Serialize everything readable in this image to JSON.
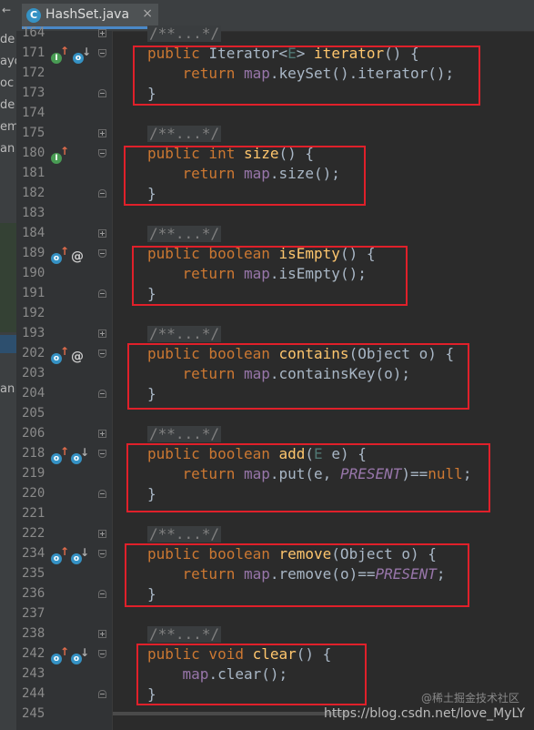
{
  "left_panel": {
    "arrow": "←",
    "items": [
      "de",
      "ayo",
      "oc",
      "de",
      "em",
      "an",
      "an"
    ]
  },
  "tab": {
    "icon_letter": "C",
    "label": "HashSet.java",
    "close": "×"
  },
  "gutter": {
    "lines": [
      {
        "num": "164",
        "icons": [],
        "fold": "plus"
      },
      {
        "num": "171",
        "icons": [
          "implements-icon",
          "overridden-icon"
        ],
        "fold": "open"
      },
      {
        "num": "172",
        "icons": [],
        "fold": ""
      },
      {
        "num": "173",
        "icons": [],
        "fold": "close"
      },
      {
        "num": "174",
        "icons": [],
        "fold": ""
      },
      {
        "num": "175",
        "icons": [],
        "fold": "plus"
      },
      {
        "num": "180",
        "icons": [
          "implements-icon"
        ],
        "fold": "open"
      },
      {
        "num": "181",
        "icons": [],
        "fold": ""
      },
      {
        "num": "182",
        "icons": [],
        "fold": "close"
      },
      {
        "num": "183",
        "icons": [],
        "fold": ""
      },
      {
        "num": "184",
        "icons": [],
        "fold": "plus"
      },
      {
        "num": "189",
        "icons": [
          "overrides-icon",
          "at-icon"
        ],
        "fold": "open"
      },
      {
        "num": "190",
        "icons": [],
        "fold": ""
      },
      {
        "num": "191",
        "icons": [],
        "fold": "close"
      },
      {
        "num": "192",
        "icons": [],
        "fold": ""
      },
      {
        "num": "193",
        "icons": [],
        "fold": "plus"
      },
      {
        "num": "202",
        "icons": [
          "overrides-icon",
          "at-icon"
        ],
        "fold": "open"
      },
      {
        "num": "203",
        "icons": [],
        "fold": ""
      },
      {
        "num": "204",
        "icons": [],
        "fold": "close"
      },
      {
        "num": "205",
        "icons": [],
        "fold": ""
      },
      {
        "num": "206",
        "icons": [],
        "fold": "plus"
      },
      {
        "num": "218",
        "icons": [
          "overrides-icon",
          "overridden-icon"
        ],
        "fold": "open"
      },
      {
        "num": "219",
        "icons": [],
        "fold": ""
      },
      {
        "num": "220",
        "icons": [],
        "fold": "close"
      },
      {
        "num": "221",
        "icons": [],
        "fold": ""
      },
      {
        "num": "222",
        "icons": [],
        "fold": "plus"
      },
      {
        "num": "234",
        "icons": [
          "overrides-icon",
          "overridden-icon"
        ],
        "fold": "open"
      },
      {
        "num": "235",
        "icons": [],
        "fold": ""
      },
      {
        "num": "236",
        "icons": [],
        "fold": "close"
      },
      {
        "num": "237",
        "icons": [],
        "fold": ""
      },
      {
        "num": "238",
        "icons": [],
        "fold": "plus"
      },
      {
        "num": "242",
        "icons": [
          "overrides-icon",
          "overridden-icon"
        ],
        "fold": "open"
      },
      {
        "num": "243",
        "icons": [],
        "fold": ""
      },
      {
        "num": "244",
        "icons": [],
        "fold": "close"
      },
      {
        "num": "245",
        "icons": [],
        "fold": ""
      }
    ]
  },
  "code": {
    "lines": [
      [
        {
          "t": "/**...*/",
          "c": "comment"
        }
      ],
      [
        {
          "t": "public ",
          "c": "kw"
        },
        {
          "t": "Iterator<",
          "c": ""
        },
        {
          "t": "E",
          "c": "gen"
        },
        {
          "t": "> ",
          "c": ""
        },
        {
          "t": "iterator",
          "c": "fn"
        },
        {
          "t": "() {",
          "c": ""
        }
      ],
      [
        {
          "t": "    return ",
          "c": "kw"
        },
        {
          "t": "map",
          "c": "fld"
        },
        {
          "t": ".keySet().iterator();",
          "c": ""
        }
      ],
      [
        {
          "t": "}",
          "c": ""
        }
      ],
      [],
      [
        {
          "t": "/**...*/",
          "c": "comment"
        }
      ],
      [
        {
          "t": "public int ",
          "c": "kw"
        },
        {
          "t": "size",
          "c": "fn"
        },
        {
          "t": "() {",
          "c": ""
        }
      ],
      [
        {
          "t": "    return ",
          "c": "kw"
        },
        {
          "t": "map",
          "c": "fld"
        },
        {
          "t": ".size();",
          "c": ""
        }
      ],
      [
        {
          "t": "}",
          "c": ""
        }
      ],
      [],
      [
        {
          "t": "/**...*/",
          "c": "comment"
        }
      ],
      [
        {
          "t": "public boolean ",
          "c": "kw"
        },
        {
          "t": "isEmpty",
          "c": "fn"
        },
        {
          "t": "() {",
          "c": ""
        }
      ],
      [
        {
          "t": "    return ",
          "c": "kw"
        },
        {
          "t": "map",
          "c": "fld"
        },
        {
          "t": ".isEmpty();",
          "c": ""
        }
      ],
      [
        {
          "t": "}",
          "c": ""
        }
      ],
      [],
      [
        {
          "t": "/**...*/",
          "c": "comment"
        }
      ],
      [
        {
          "t": "public boolean ",
          "c": "kw"
        },
        {
          "t": "contains",
          "c": "fn"
        },
        {
          "t": "(Object o) {",
          "c": ""
        }
      ],
      [
        {
          "t": "    return ",
          "c": "kw"
        },
        {
          "t": "map",
          "c": "fld"
        },
        {
          "t": ".containsKey(o);",
          "c": ""
        }
      ],
      [
        {
          "t": "}",
          "c": ""
        }
      ],
      [],
      [
        {
          "t": "/**...*/",
          "c": "comment"
        }
      ],
      [
        {
          "t": "public boolean ",
          "c": "kw"
        },
        {
          "t": "add",
          "c": "fn"
        },
        {
          "t": "(",
          "c": ""
        },
        {
          "t": "E",
          "c": "gen"
        },
        {
          "t": " e) {",
          "c": ""
        }
      ],
      [
        {
          "t": "    return ",
          "c": "kw"
        },
        {
          "t": "map",
          "c": "fld"
        },
        {
          "t": ".put(e, ",
          "c": ""
        },
        {
          "t": "PRESENT",
          "c": "const"
        },
        {
          "t": ")==",
          "c": ""
        },
        {
          "t": "null",
          "c": "kw"
        },
        {
          "t": ";",
          "c": ""
        }
      ],
      [
        {
          "t": "}",
          "c": ""
        }
      ],
      [],
      [
        {
          "t": "/**...*/",
          "c": "comment"
        }
      ],
      [
        {
          "t": "public boolean ",
          "c": "kw"
        },
        {
          "t": "remove",
          "c": "fn"
        },
        {
          "t": "(Object o) {",
          "c": ""
        }
      ],
      [
        {
          "t": "    return ",
          "c": "kw"
        },
        {
          "t": "map",
          "c": "fld"
        },
        {
          "t": ".remove(o)==",
          "c": ""
        },
        {
          "t": "PRESENT",
          "c": "const"
        },
        {
          "t": ";",
          "c": ""
        }
      ],
      [
        {
          "t": "}",
          "c": ""
        }
      ],
      [],
      [
        {
          "t": "/**...*/",
          "c": "comment"
        }
      ],
      [
        {
          "t": "public void ",
          "c": "kw"
        },
        {
          "t": "clear",
          "c": "fn"
        },
        {
          "t": "() {",
          "c": ""
        }
      ],
      [
        {
          "t": "    ",
          "c": ""
        },
        {
          "t": "map",
          "c": "fld"
        },
        {
          "t": ".clear();",
          "c": ""
        }
      ],
      [
        {
          "t": "}",
          "c": ""
        }
      ],
      []
    ]
  },
  "watermark": {
    "url": "https://blog.csdn.net/love_MyLY",
    "cn": "@稀土掘金技术社区"
  }
}
